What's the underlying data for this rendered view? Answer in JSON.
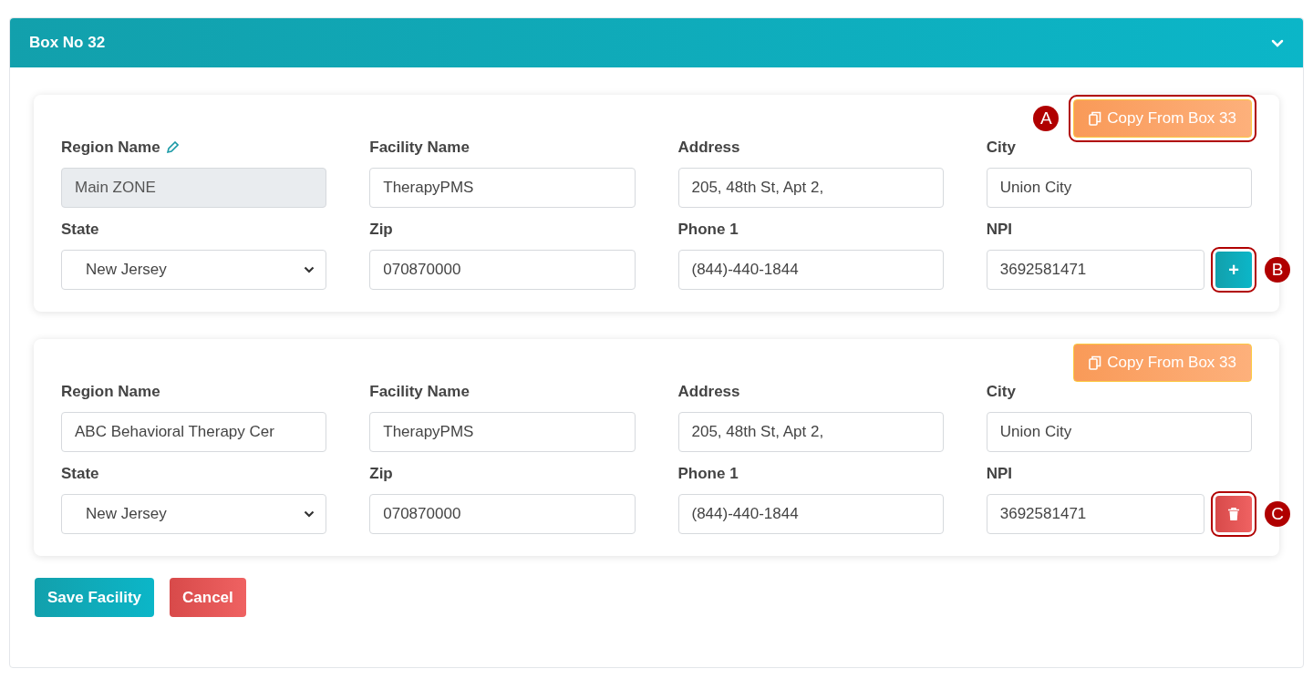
{
  "panel": {
    "title": "Box No 32",
    "expanded": true
  },
  "facilities": [
    {
      "copy_button": {
        "label": "Copy From Box 33",
        "callout": "A"
      },
      "fields": [
        {
          "label": "Region Name",
          "value": "Main ZONE",
          "kind": "text",
          "disabled": true,
          "edit_icon": true
        },
        {
          "label": "Facility Name",
          "value": "TherapyPMS",
          "kind": "text",
          "disabled": false
        },
        {
          "label": "Address",
          "value": "205, 48th St, Apt 2,",
          "kind": "text",
          "disabled": false
        },
        {
          "label": "City",
          "value": "Union City",
          "kind": "text",
          "disabled": false
        },
        {
          "label": "State",
          "value": "New Jersey",
          "kind": "select",
          "disabled": false
        },
        {
          "label": "Zip",
          "value": "070870000",
          "kind": "text",
          "disabled": false
        },
        {
          "label": "Phone 1",
          "value": "(844)-440-1844",
          "kind": "text",
          "disabled": false
        },
        {
          "label": "NPI",
          "value": "3692581471",
          "kind": "text",
          "disabled": false
        }
      ],
      "action": {
        "kind": "add",
        "label": "+",
        "callout": "B"
      }
    },
    {
      "copy_button": {
        "label": "Copy From Box 33"
      },
      "fields": [
        {
          "label": "Region Name",
          "value": "ABC Behavioral Therapy Cer",
          "kind": "text",
          "disabled": false
        },
        {
          "label": "Facility Name",
          "value": "TherapyPMS",
          "kind": "text",
          "disabled": false
        },
        {
          "label": "Address",
          "value": "205, 48th St, Apt 2,",
          "kind": "text",
          "disabled": false
        },
        {
          "label": "City",
          "value": "Union City",
          "kind": "text",
          "disabled": false
        },
        {
          "label": "State",
          "value": "New Jersey",
          "kind": "select",
          "disabled": false
        },
        {
          "label": "Zip",
          "value": "070870000",
          "kind": "text",
          "disabled": false
        },
        {
          "label": "Phone 1",
          "value": "(844)-440-1844",
          "kind": "text",
          "disabled": false
        },
        {
          "label": "NPI",
          "value": "3692581471",
          "kind": "text",
          "disabled": false
        }
      ],
      "action": {
        "kind": "delete",
        "callout": "C"
      }
    }
  ],
  "buttons": [
    {
      "label": "Save Facility",
      "kind": "primary"
    },
    {
      "label": "Cancel",
      "kind": "danger"
    }
  ]
}
